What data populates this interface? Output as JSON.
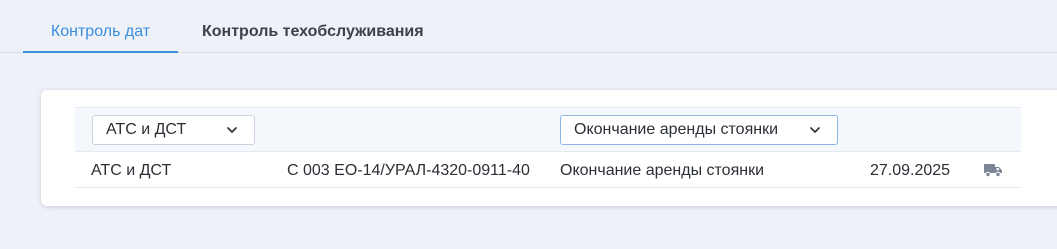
{
  "tabs": [
    {
      "label": "Контроль дат",
      "active": true
    },
    {
      "label": "Контроль техобслуживания",
      "active": false
    }
  ],
  "filters": {
    "vehicle_type": {
      "value": "АТС и ДСТ",
      "icon": "chevron-down-icon"
    },
    "event_type": {
      "value": "Окончание аренды стоянки",
      "icon": "chevron-down-icon"
    }
  },
  "rows": [
    {
      "vehicle_type": "АТС и ДСТ",
      "object": "С 003 ЕО-14/УРАЛ-4320-0911-40",
      "event": "Окончание аренды стоянки",
      "date": "27.09.2025",
      "icon": "truck-icon"
    }
  ],
  "colors": {
    "accent": "#3a8dde",
    "background": "#eef1f7",
    "card": "#ffffff",
    "icon": "#7c8594"
  }
}
